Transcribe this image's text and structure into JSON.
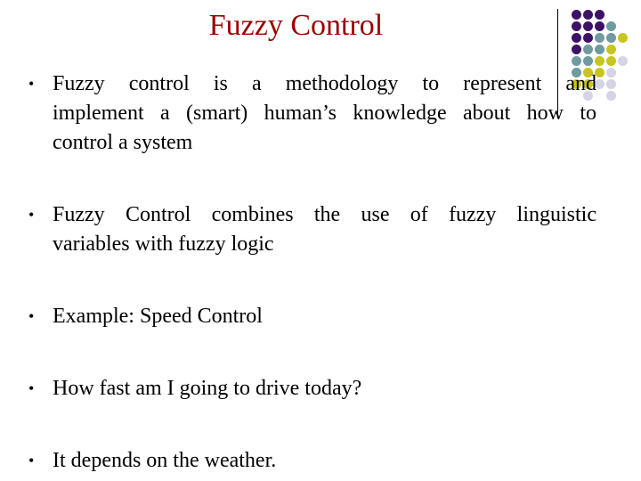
{
  "slide": {
    "title": "Fuzzy Control",
    "title_color": "#990000",
    "bullet_glyph": "•",
    "bullets": [
      {
        "lines": [
          "Fuzzy control is a methodology to represent and",
          "implement a (smart) human’s knowledge about how to",
          "control a system"
        ]
      },
      {
        "lines": [
          "Fuzzy Control combines the use of fuzzy linguistic",
          "variables with fuzzy logic"
        ]
      },
      {
        "lines": [
          "Example: Speed Control"
        ]
      },
      {
        "lines": [
          "How fast am I going to drive today?"
        ]
      },
      {
        "lines": [
          "It depends on the weather."
        ]
      }
    ]
  },
  "decoration": {
    "palette": {
      "purple": "#3d1266",
      "teal": "#6f9aa0",
      "yellow": "#c8c51f",
      "lavender": "#d4d4e6"
    },
    "dot_grid": [
      [
        "purple",
        "purple",
        "purple",
        null,
        null,
        null
      ],
      [
        "purple",
        "purple",
        "purple",
        "teal",
        null,
        null
      ],
      [
        "purple",
        "purple",
        "teal",
        "teal",
        "yellow",
        null
      ],
      [
        "purple",
        "teal",
        "teal",
        "yellow",
        null,
        null
      ],
      [
        "teal",
        "teal",
        "yellow",
        "yellow",
        "lavender",
        null
      ],
      [
        "teal",
        "yellow",
        "yellow",
        "lavender",
        null,
        null
      ],
      [
        "yellow",
        "yellow",
        "lavender",
        "lavender",
        null,
        null
      ],
      [
        null,
        "lavender",
        null,
        "lavender",
        null,
        null
      ]
    ]
  }
}
